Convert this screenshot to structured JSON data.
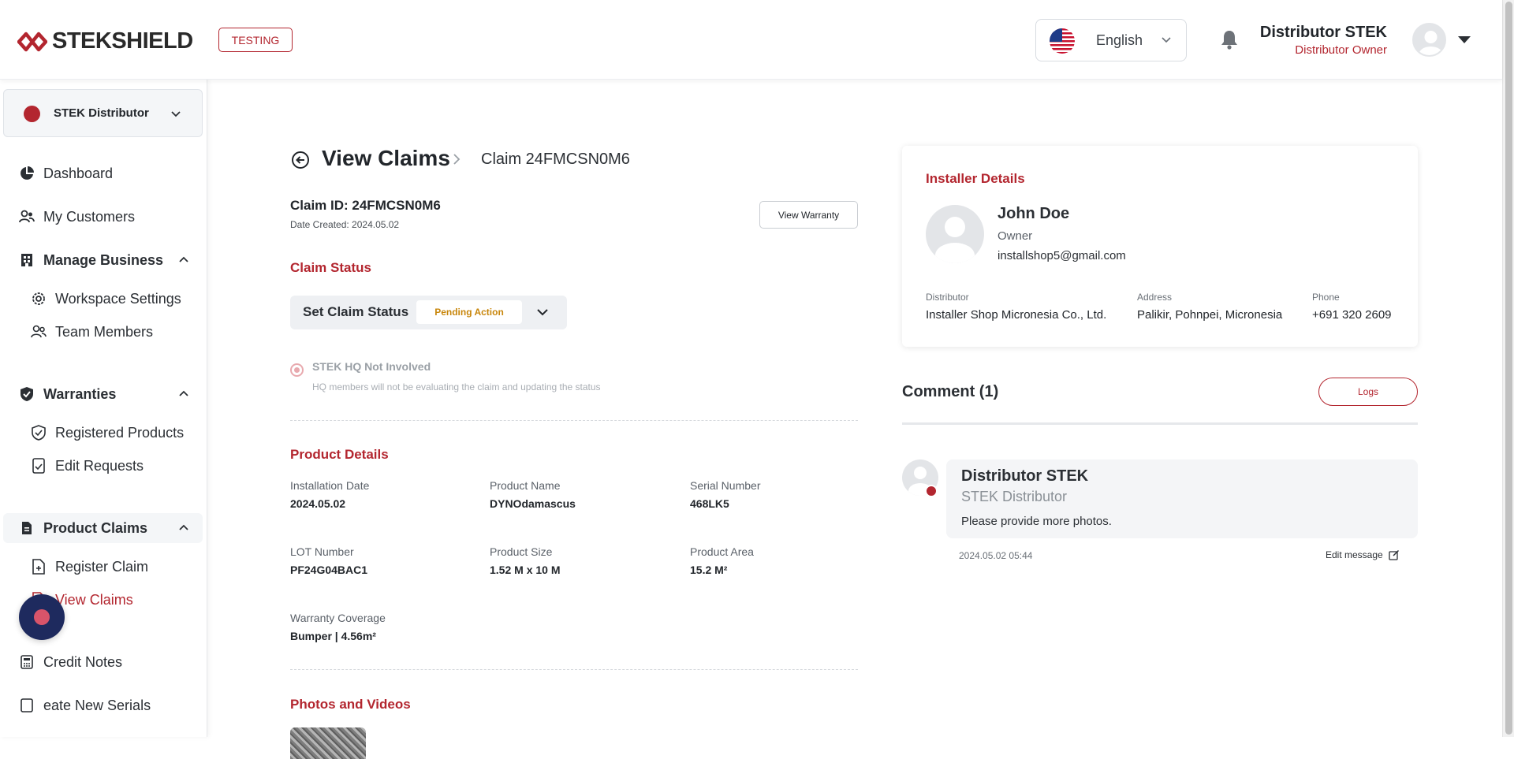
{
  "header": {
    "brand": "STEKSHIELD",
    "environment_badge": "TESTING",
    "language": "English",
    "user_name": "Distributor STEK",
    "user_role": "Distributor Owner"
  },
  "sidebar": {
    "org_selector": "STEK Distributor",
    "items": [
      {
        "label": "Dashboard",
        "icon": "pie-chart-icon"
      },
      {
        "label": "My Customers",
        "icon": "users-icon"
      },
      {
        "label": "Manage Business",
        "icon": "building-icon"
      },
      {
        "label": "Workspace Settings",
        "icon": "gear-icon"
      },
      {
        "label": "Team Members",
        "icon": "team-icon"
      },
      {
        "label": "Warranties",
        "icon": "shield-check-icon"
      },
      {
        "label": "Registered Products",
        "icon": "shield-outline-icon"
      },
      {
        "label": "Edit Requests",
        "icon": "document-edit-icon"
      },
      {
        "label": "Product Claims",
        "icon": "document-icon"
      },
      {
        "label": "Register Claim",
        "icon": "document-plus-icon"
      },
      {
        "label": "View Claims",
        "icon": "document-list-icon"
      },
      {
        "label": "Credit Notes",
        "icon": "calculator-icon"
      },
      {
        "label": "eate New Serials",
        "icon": "serial-icon"
      }
    ]
  },
  "breadcrumb": {
    "title": "View Claims",
    "current": "Claim 24FMCSN0M6"
  },
  "claim": {
    "id_line": "Claim ID: 24FMCSN0M6",
    "date_created": "Date Created: 2024.05.02",
    "view_warranty_label": "View Warranty",
    "status_section_title": "Claim Status",
    "set_status_label": "Set Claim Status",
    "status_value": "Pending Action",
    "hq_option_label": "STEK HQ Not Involved",
    "hq_option_help": "HQ members will not be evaluating the claim and updating the status"
  },
  "product_details": {
    "title": "Product Details",
    "fields": [
      {
        "label": "Installation Date",
        "value": "2024.05.02"
      },
      {
        "label": "Product Name",
        "value": "DYNOdamascus"
      },
      {
        "label": "Serial Number",
        "value": "468LK5"
      },
      {
        "label": "LOT Number",
        "value": "PF24G04BAC1"
      },
      {
        "label": "Product Size",
        "value": "1.52 M x 10 M"
      },
      {
        "label": "Product Area",
        "value": "15.2 M²"
      },
      {
        "label": "Warranty Coverage",
        "value": "Bumper | 4.56m²"
      }
    ]
  },
  "media": {
    "title": "Photos and Videos"
  },
  "installer": {
    "title": "Installer Details",
    "name": "John Doe",
    "role": "Owner",
    "email": "installshop5@gmail.com",
    "distributor_label": "Distributor",
    "distributor_value": "Installer Shop Micronesia Co., Ltd.",
    "address_label": "Address",
    "address_value": "Palikir, Pohnpei, Micronesia",
    "phone_label": "Phone",
    "phone_value": "+691 320 2609"
  },
  "comments": {
    "title": "Comment (1)",
    "logs_label": "Logs",
    "items": [
      {
        "author": "Distributor STEK",
        "org": "STEK Distributor",
        "text": "Please provide more photos.",
        "timestamp": "2024.05.02 05:44",
        "edit_label": "Edit message"
      }
    ]
  },
  "colors": {
    "brand_red": "#b3262f",
    "pending_orange": "#c8860b",
    "muted_bg": "#f4f6f8"
  }
}
